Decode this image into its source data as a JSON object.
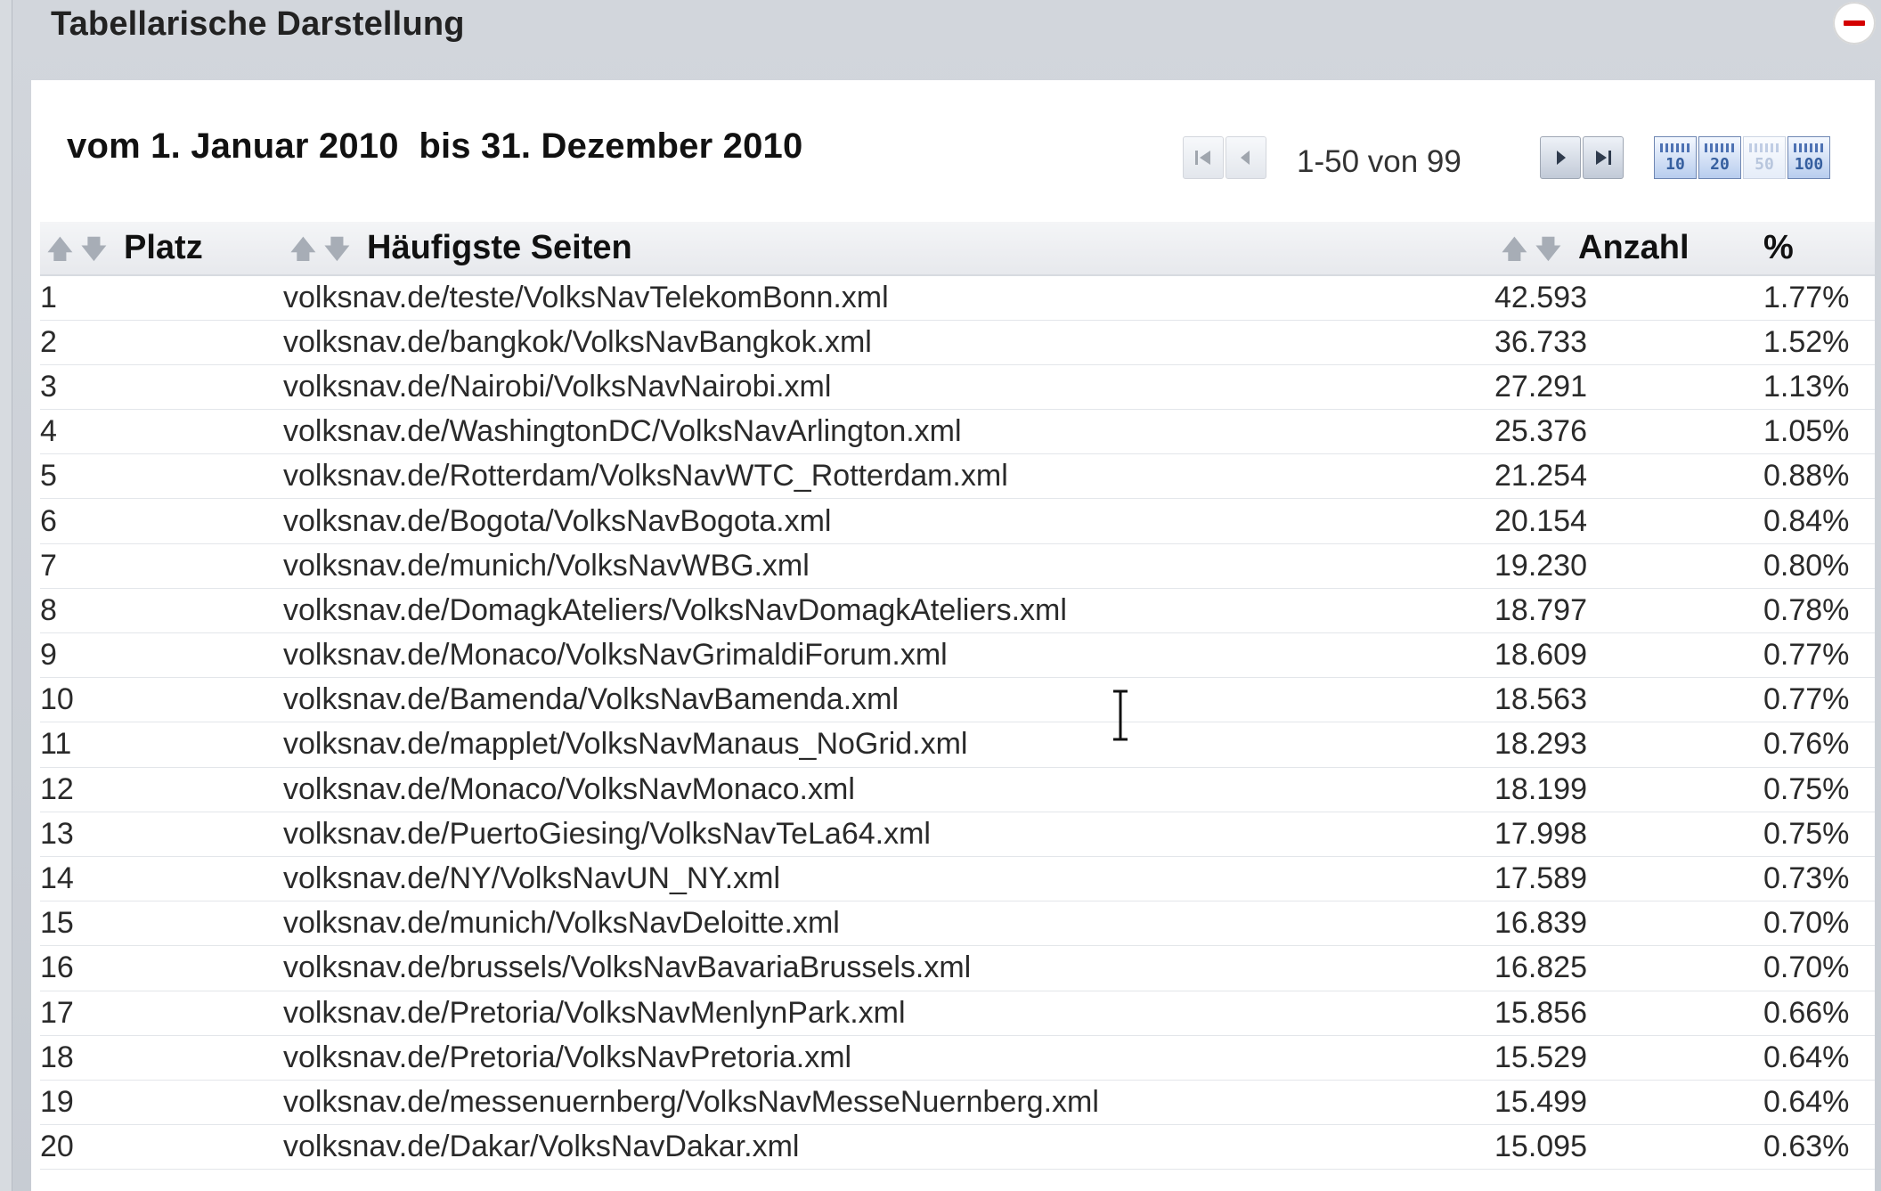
{
  "panel": {
    "title": "Tabellarische Darstellung",
    "collapse_icon": "minus-circle-icon"
  },
  "period": "vom 1. Januar 2010  bis 31. Dezember 2010",
  "pagination": {
    "info": "1-50 von 99",
    "first_icon": "first-page-icon",
    "prev_icon": "previous-page-icon",
    "next_icon": "next-page-icon",
    "last_icon": "last-page-icon",
    "page_sizes": [
      "10",
      "20",
      "50",
      "100"
    ],
    "selected_page_size": "50"
  },
  "table": {
    "headers": {
      "rank": "Platz",
      "page": "Häufigste Seiten",
      "count": "Anzahl",
      "percent": "%"
    },
    "rows": [
      {
        "rank": "1",
        "page": "volksnav.de/teste/VolksNavTelekomBonn.xml",
        "count": "42.593",
        "percent": "1.77%"
      },
      {
        "rank": "2",
        "page": "volksnav.de/bangkok/VolksNavBangkok.xml",
        "count": "36.733",
        "percent": "1.52%"
      },
      {
        "rank": "3",
        "page": "volksnav.de/Nairobi/VolksNavNairobi.xml",
        "count": "27.291",
        "percent": "1.13%"
      },
      {
        "rank": "4",
        "page": "volksnav.de/WashingtonDC/VolksNavArlington.xml",
        "count": "25.376",
        "percent": "1.05%"
      },
      {
        "rank": "5",
        "page": "volksnav.de/Rotterdam/VolksNavWTC_Rotterdam.xml",
        "count": "21.254",
        "percent": "0.88%"
      },
      {
        "rank": "6",
        "page": "volksnav.de/Bogota/VolksNavBogota.xml",
        "count": "20.154",
        "percent": "0.84%"
      },
      {
        "rank": "7",
        "page": "volksnav.de/munich/VolksNavWBG.xml",
        "count": "19.230",
        "percent": "0.80%"
      },
      {
        "rank": "8",
        "page": "volksnav.de/DomagkAteliers/VolksNavDomagkAteliers.xml",
        "count": "18.797",
        "percent": "0.78%"
      },
      {
        "rank": "9",
        "page": "volksnav.de/Monaco/VolksNavGrimaldiForum.xml",
        "count": "18.609",
        "percent": "0.77%"
      },
      {
        "rank": "10",
        "page": "volksnav.de/Bamenda/VolksNavBamenda.xml",
        "count": "18.563",
        "percent": "0.77%"
      },
      {
        "rank": "11",
        "page": "volksnav.de/mapplet/VolksNavManaus_NoGrid.xml",
        "count": "18.293",
        "percent": "0.76%"
      },
      {
        "rank": "12",
        "page": "volksnav.de/Monaco/VolksNavMonaco.xml",
        "count": "18.199",
        "percent": "0.75%"
      },
      {
        "rank": "13",
        "page": "volksnav.de/PuertoGiesing/VolksNavTeLa64.xml",
        "count": "17.998",
        "percent": "0.75%"
      },
      {
        "rank": "14",
        "page": "volksnav.de/NY/VolksNavUN_NY.xml",
        "count": "17.589",
        "percent": "0.73%"
      },
      {
        "rank": "15",
        "page": "volksnav.de/munich/VolksNavDeloitte.xml",
        "count": "16.839",
        "percent": "0.70%"
      },
      {
        "rank": "16",
        "page": "volksnav.de/brussels/VolksNavBavariaBrussels.xml",
        "count": "16.825",
        "percent": "0.70%"
      },
      {
        "rank": "17",
        "page": "volksnav.de/Pretoria/VolksNavMenlynPark.xml",
        "count": "15.856",
        "percent": "0.66%"
      },
      {
        "rank": "18",
        "page": "volksnav.de/Pretoria/VolksNavPretoria.xml",
        "count": "15.529",
        "percent": "0.64%"
      },
      {
        "rank": "19",
        "page": "volksnav.de/messenuernberg/VolksNavMesseNuernberg.xml",
        "count": "15.499",
        "percent": "0.64%"
      },
      {
        "rank": "20",
        "page": "volksnav.de/Dakar/VolksNavDakar.xml",
        "count": "15.095",
        "percent": "0.63%"
      }
    ]
  },
  "colors": {
    "panel_bg": "#c9ced5",
    "header_bg": "#eceef1",
    "accent_blue": "#4d72b3",
    "collapse_red": "#d40000"
  }
}
